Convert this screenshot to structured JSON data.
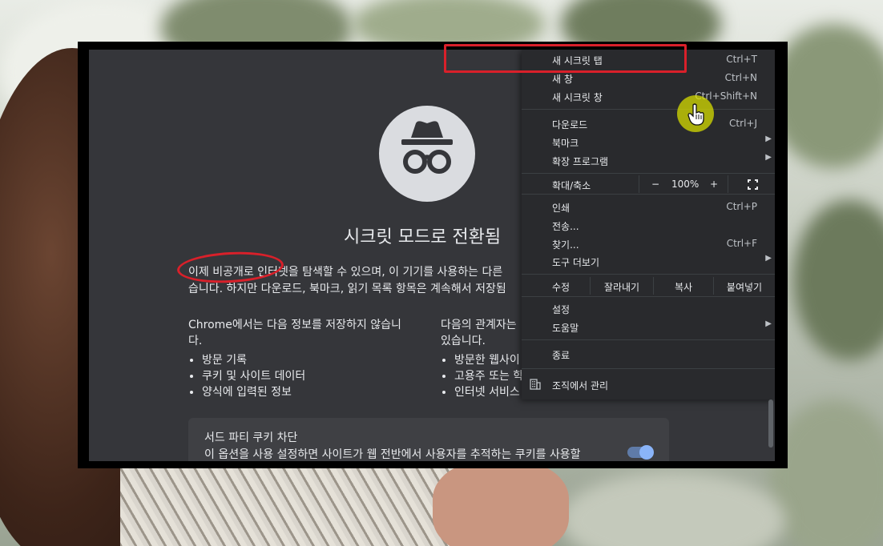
{
  "page": {
    "title": "시크릿 모드로 전환됨",
    "intro": "이제 비공개로 인터넷을 탐색할 수 있으며, 이 기기를 사용하는 다른\n습니다. 하지만 다운로드, 북마크, 읽기 목록 항목은 계속해서 저장됨",
    "left_col_heading": "Chrome에서는 다음 정보를 저장하지 않습니\n다.",
    "left_col_items": [
      "방문 기록",
      "쿠키 및 사이트 데이터",
      "양식에 입력된 정보"
    ],
    "right_col_heading": "다음의 관계자는\n있습니다.",
    "right_col_items": [
      "방문한 웹사이",
      "고용주 또는 학",
      "인터넷 서비스"
    ],
    "cookie_card": {
      "title": "서드 파티 쿠키 차단",
      "description": "이 옵션을 사용 설정하면 사이트가 웹 전반에서 사용자를 추적하는 쿠키를 사용할",
      "toggle_on": true
    }
  },
  "menu": {
    "new_tab": {
      "label": "새 시크릿 탭",
      "shortcut": "Ctrl+T"
    },
    "new_window": {
      "label": "새 창",
      "shortcut": "Ctrl+N"
    },
    "new_incognito": {
      "label": "새 시크릿 창",
      "shortcut": "Ctrl+Shift+N"
    },
    "downloads": {
      "label": "다운로드",
      "shortcut": "Ctrl+J"
    },
    "bookmarks": {
      "label": "북마크"
    },
    "extensions": {
      "label": "확장 프로그램"
    },
    "zoom": {
      "label": "확대/축소",
      "minus": "−",
      "value": "100%",
      "plus": "+"
    },
    "print": {
      "label": "인쇄",
      "shortcut": "Ctrl+P"
    },
    "cast": {
      "label": "전송..."
    },
    "find": {
      "label": "찾기...",
      "shortcut": "Ctrl+F"
    },
    "more_tools": {
      "label": "도구 더보기"
    },
    "edit": {
      "label": "수정",
      "cut": "잘라내기",
      "copy": "복사",
      "paste": "붙여넣기"
    },
    "settings": {
      "label": "설정"
    },
    "help": {
      "label": "도움말"
    },
    "exit": {
      "label": "종료"
    },
    "managed": {
      "label": "조직에서 관리"
    }
  },
  "colors": {
    "highlight": "#d9202a",
    "menu_bg": "#292a2d",
    "page_bg": "#35363a",
    "toggle": "#8ab4f8"
  }
}
